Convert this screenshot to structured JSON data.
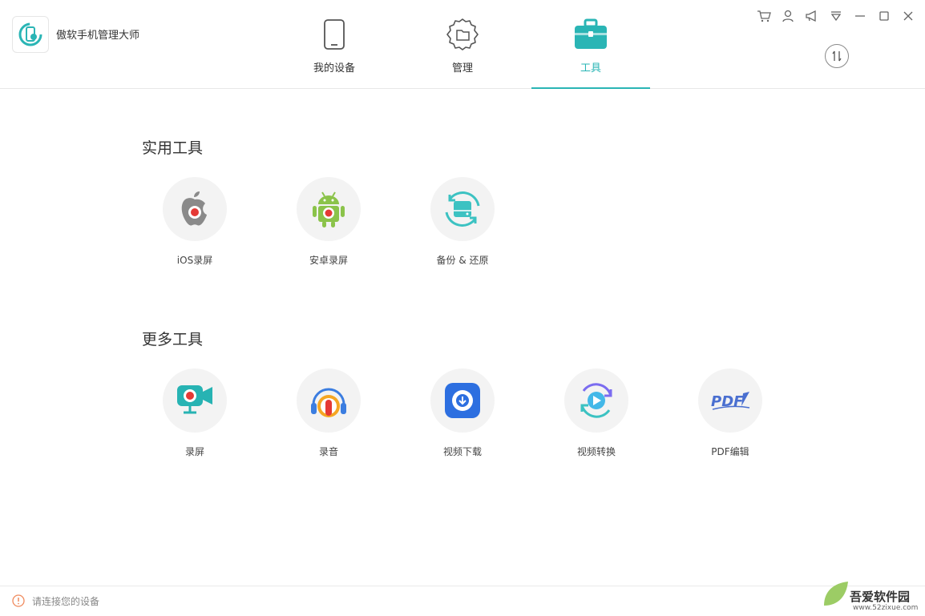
{
  "app": {
    "title": "傲软手机管理大师"
  },
  "nav": {
    "tabs": [
      {
        "label": "我的设备",
        "icon": "phone-icon"
      },
      {
        "label": "管理",
        "icon": "gear-folder-icon"
      },
      {
        "label": "工具",
        "icon": "toolbox-icon",
        "active": true
      }
    ]
  },
  "window_controls": [
    "cart-icon",
    "user-icon",
    "megaphone-icon",
    "menu-icon",
    "minimize-icon",
    "maximize-icon",
    "close-icon"
  ],
  "sections": {
    "practical": {
      "title": "实用工具",
      "tools": [
        {
          "label": "iOS录屏",
          "icon": "apple-record-icon"
        },
        {
          "label": "安卓录屏",
          "icon": "android-record-icon"
        },
        {
          "label": "备份 & 还原",
          "icon": "backup-restore-icon"
        }
      ]
    },
    "more": {
      "title": "更多工具",
      "tools": [
        {
          "label": "录屏",
          "icon": "screen-record-icon"
        },
        {
          "label": "录音",
          "icon": "audio-record-icon"
        },
        {
          "label": "视频下载",
          "icon": "video-download-icon"
        },
        {
          "label": "视频转换",
          "icon": "video-convert-icon"
        },
        {
          "label": "PDF编辑",
          "icon": "pdf-edit-icon"
        }
      ]
    }
  },
  "icon_texts": {
    "pdf": "PDF"
  },
  "footer": {
    "status": "请连接您的设备"
  },
  "watermark": {
    "text": "吾爱软件园",
    "url": "www.52zixue.com"
  },
  "colors": {
    "accent": "#2ab5b5",
    "android": "#8bc34a",
    "record_red": "#e53935"
  }
}
